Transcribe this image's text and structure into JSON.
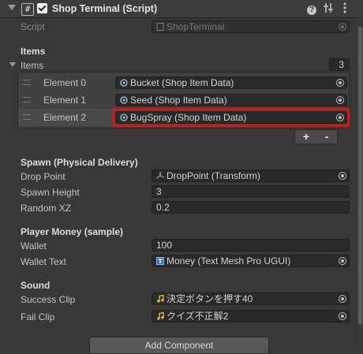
{
  "header": {
    "title": "Shop Terminal (Script)",
    "enabled": true,
    "icons": [
      "fold-arrow-icon",
      "script-hash-icon",
      "help-icon",
      "preset-icon",
      "context-menu-icon"
    ]
  },
  "script_row": {
    "label": "Script",
    "value": "ShopTerminal"
  },
  "items_section": {
    "header": "Items",
    "list_label": "Items",
    "count": "3",
    "elements": [
      {
        "label": "Element 0",
        "value": "Bucket (Shop Item Data)"
      },
      {
        "label": "Element 1",
        "value": "Seed (Shop Item Data)"
      },
      {
        "label": "Element 2",
        "value": "BugSpray (Shop Item Data)"
      }
    ],
    "add_label": "+",
    "remove_label": "-"
  },
  "spawn_section": {
    "header": "Spawn (Physical Delivery)",
    "drop_point_label": "Drop Point",
    "drop_point_value": "DropPoint (Transform)",
    "spawn_height_label": "Spawn Height",
    "spawn_height_value": "3",
    "random_xz_label": "Random XZ",
    "random_xz_value": "0.2"
  },
  "money_section": {
    "header": "Player Money (sample)",
    "wallet_label": "Wallet",
    "wallet_value": "100",
    "wallet_text_label": "Wallet Text",
    "wallet_text_value": "Money (Text Mesh Pro UGUI)"
  },
  "sound_section": {
    "header": "Sound",
    "success_clip_label": "Success Clip",
    "success_clip_value": "決定ボタンを押す40",
    "fail_clip_label": "Fail Clip",
    "fail_clip_value": "クイズ不正解2"
  },
  "add_component_label": "Add Component",
  "colors": {
    "background": "#383838",
    "field": "#2a2a2a",
    "highlight": "#e01010",
    "text": "#d2d2d2",
    "audio_icon": "#e8c14a"
  }
}
